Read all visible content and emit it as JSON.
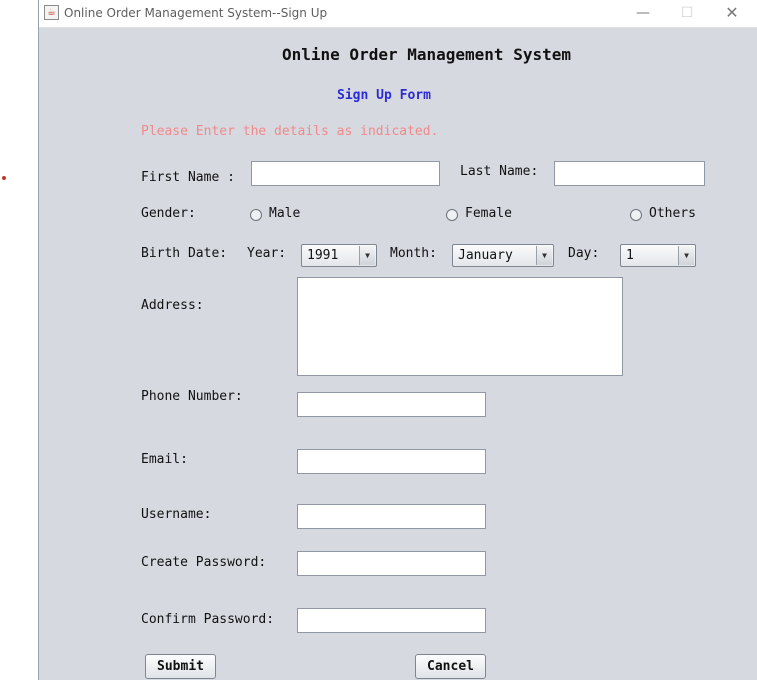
{
  "window": {
    "title": "Online Order Management System--Sign Up"
  },
  "header": {
    "title": "Online Order Management System",
    "subtitle": "Sign Up Form",
    "instruction": "Please Enter the details as indicated."
  },
  "labels": {
    "first_name": "First Name :",
    "last_name": "Last Name:",
    "gender": "Gender:",
    "male": "Male",
    "female": "Female",
    "others": "Others",
    "birth_date": "Birth Date:",
    "year": "Year:",
    "month": "Month:",
    "day": "Day:",
    "address": "Address:",
    "phone": "Phone Number:",
    "email": "Email:",
    "username": "Username:",
    "create_password": "Create Password:",
    "confirm_password": "Confirm Password:"
  },
  "values": {
    "first_name": "",
    "last_name": "",
    "address": "",
    "phone": "",
    "email": "",
    "username": "",
    "year": "1991",
    "month": "January",
    "day": "1"
  },
  "buttons": {
    "submit": "Submit",
    "cancel": "Cancel"
  },
  "icons": {
    "app": "java-cup-icon",
    "minimize": "minimize-icon",
    "maximize": "maximize-icon",
    "close": "close-icon",
    "dropdown": "dropdown-arrow-icon"
  },
  "colors": {
    "title_blue": "#2b2bd6",
    "instruction": "#f08a8a",
    "panel": "#d6d9df"
  }
}
